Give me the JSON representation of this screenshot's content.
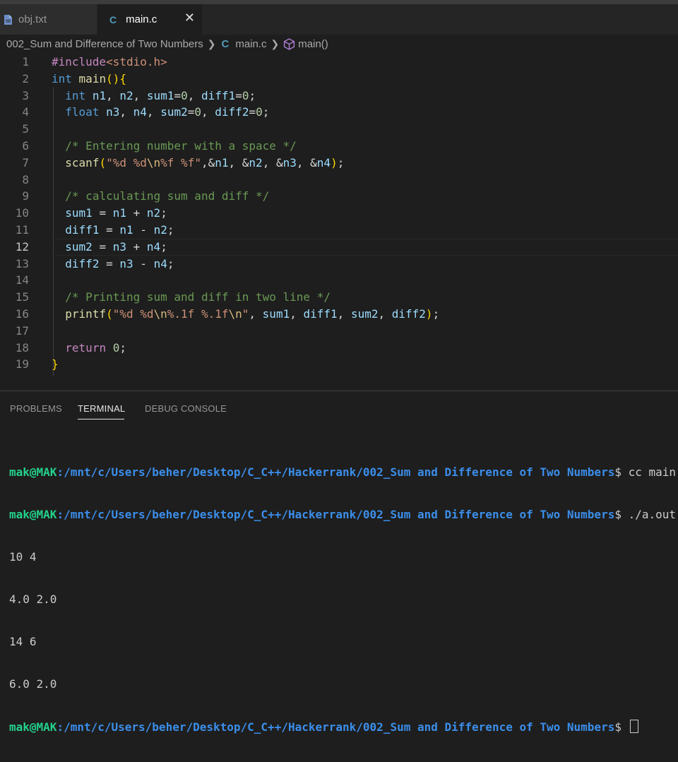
{
  "tabs": [
    {
      "label": "obj.txt",
      "active": false,
      "icon": "file-icon"
    },
    {
      "label": "main.c",
      "active": true,
      "icon": "c-language-icon",
      "close": "✕"
    }
  ],
  "breadcrumb": {
    "folder": "002_Sum and Difference of Two Numbers",
    "c_glyph": "C",
    "file": "main.c",
    "symbol": "main()"
  },
  "editor": {
    "active_line": 12,
    "line_numbers": [
      "1",
      "2",
      "3",
      "4",
      "5",
      "6",
      "7",
      "8",
      "9",
      "10",
      "11",
      "12",
      "13",
      "14",
      "15",
      "16",
      "17",
      "18",
      "19"
    ],
    "lines": [
      "#include<stdio.h>",
      "int main(){",
      "  int n1, n2, sum1=0, diff1=0;",
      "  float n3, n4, sum2=0, diff2=0;",
      "",
      "  /* Entering number with a space */",
      "  scanf(\"%d %d\\n%f %f\",&n1, &n2, &n3, &n4);",
      "",
      "  /* calculating sum and diff */",
      "  sum1 = n1 + n2;",
      "  diff1 = n1 - n2;",
      "  sum2 = n3 + n4;",
      "  diff2 = n3 - n4;",
      "",
      "  /* Printing sum and diff in two line */",
      "  printf(\"%d %d\\n%.1f %.1f\\n\", sum1, diff1, sum2, diff2);",
      "",
      "  return 0;",
      "}"
    ]
  },
  "panel": {
    "tabs": [
      "PROBLEMS",
      "TERMINAL",
      "DEBUG CONSOLE"
    ],
    "active_tab": "TERMINAL"
  },
  "terminal": {
    "user": "mak@MAK",
    "path": ":/mnt/c/Users/beher/Desktop/C_C++/Hackerrank/002_Sum and Difference of Two Numbers",
    "prompt_symbol": "$",
    "commands": [
      "cc main.c",
      "./a.out"
    ],
    "output": [
      "10 4",
      "4.0 2.0",
      "14 6",
      "6.0 2.0"
    ]
  },
  "colors": {
    "keyword": "#569cd6",
    "string": "#ce9178",
    "comment": "#6a9955",
    "variable": "#9cdcfe",
    "number": "#b5cea8",
    "function": "#dcdcaa",
    "terminal_user": "#23d18b",
    "terminal_path": "#3b8eea"
  }
}
